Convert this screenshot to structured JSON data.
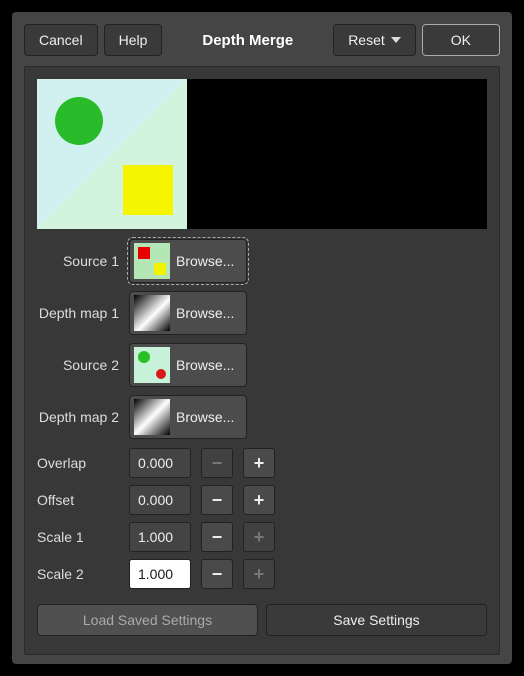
{
  "titlebar": {
    "cancel": "Cancel",
    "help": "Help",
    "title": "Depth Merge",
    "reset": "Reset",
    "ok": "OK"
  },
  "rows": {
    "source1": {
      "label": "Source 1",
      "button": "Browse..."
    },
    "depth1": {
      "label": "Depth map 1",
      "button": "Browse..."
    },
    "source2": {
      "label": "Source 2",
      "button": "Browse..."
    },
    "depth2": {
      "label": "Depth map 2",
      "button": "Browse..."
    }
  },
  "params": {
    "overlap": {
      "label": "Overlap",
      "value": "0.000"
    },
    "offset": {
      "label": "Offset",
      "value": "0.000"
    },
    "scale1": {
      "label": "Scale 1",
      "value": "1.000"
    },
    "scale2": {
      "label": "Scale 2",
      "value": "1.000"
    }
  },
  "footer": {
    "load": "Load Saved Settings",
    "save": "Save Settings"
  },
  "icons": {
    "chevron_down": "chevron-down-icon"
  }
}
